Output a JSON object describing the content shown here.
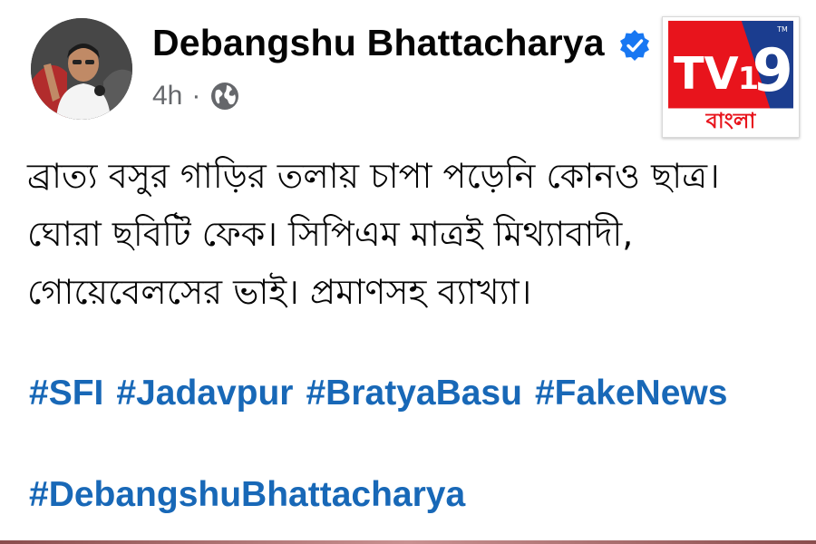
{
  "post": {
    "author": "Debangshu Bhattacharya",
    "verified": true,
    "timestamp": "4h",
    "separator": "·",
    "audience_icon": "globe-icon",
    "text_lines": [
      "ব্রাত্য বসুর গাড়ির তলায় চাপা পড়েনি কোনও ছাত্র।",
      "ঘোরা ছবিটি ফেক। সিপিএম মাত্রই মিথ্যাবাদী,",
      "গোয়েবেলসের ভাই। প্রমাণসহ ব্যাখ্যা।"
    ],
    "hashtags": [
      "#SFI",
      "#Jadavpur",
      "#BratyaBasu",
      "#FakeNews"
    ],
    "hashtags_line2": [
      "#DebangshuBhattacharya"
    ]
  },
  "logo": {
    "name": "TV9",
    "subtitle": "বাংলা",
    "tm": "TM"
  },
  "colors": {
    "hashtag": "#1868b7",
    "verified_badge": "#1877f2",
    "meta_text": "#65676b",
    "logo_red": "#e8141c",
    "logo_blue": "#1b3d8f"
  }
}
